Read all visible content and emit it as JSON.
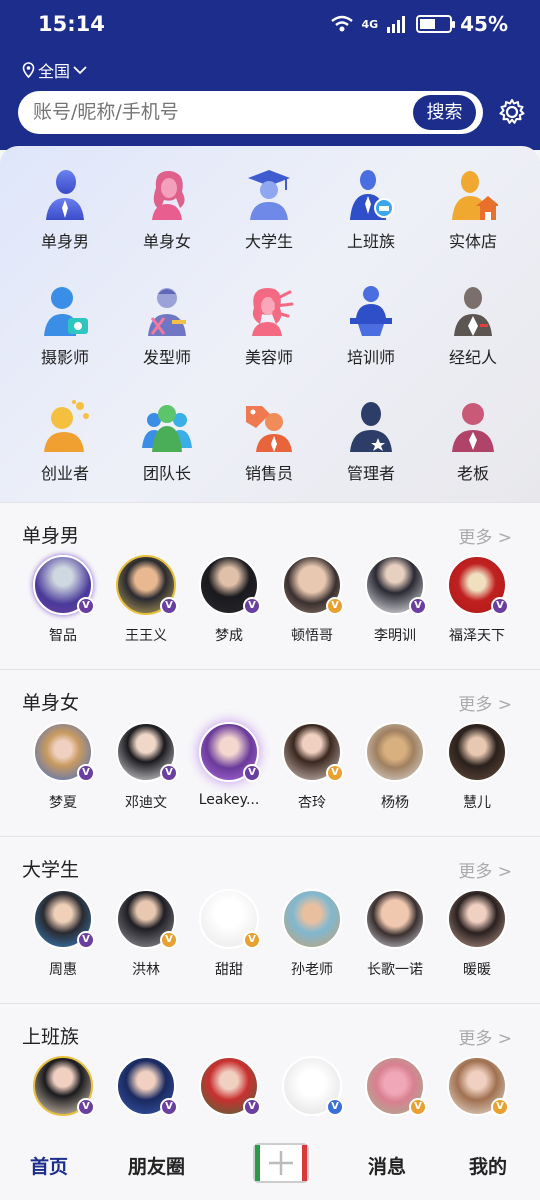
{
  "status": {
    "time": "15:14",
    "network": "4G",
    "battery": "45%",
    "battery_level": 0.45
  },
  "location": {
    "label": "全国"
  },
  "search": {
    "placeholder": "账号/昵称/手机号",
    "button": "搜索"
  },
  "categories": [
    {
      "label": "单身男",
      "icon": "single-man-icon"
    },
    {
      "label": "单身女",
      "icon": "single-woman-icon"
    },
    {
      "label": "大学生",
      "icon": "graduate-icon"
    },
    {
      "label": "上班族",
      "icon": "office-worker-icon"
    },
    {
      "label": "实体店",
      "icon": "store-icon"
    },
    {
      "label": "摄影师",
      "icon": "photographer-icon"
    },
    {
      "label": "发型师",
      "icon": "hairstylist-icon"
    },
    {
      "label": "美容师",
      "icon": "beautician-icon"
    },
    {
      "label": "培训师",
      "icon": "trainer-icon"
    },
    {
      "label": "经纪人",
      "icon": "agent-icon"
    },
    {
      "label": "创业者",
      "icon": "entrepreneur-icon"
    },
    {
      "label": "团队长",
      "icon": "team-leader-icon"
    },
    {
      "label": "销售员",
      "icon": "salesperson-icon"
    },
    {
      "label": "管理者",
      "icon": "manager-icon"
    },
    {
      "label": "老板",
      "icon": "boss-icon"
    }
  ],
  "sections": [
    {
      "title": "单身男",
      "more": "更多 >",
      "people": [
        {
          "name": "智品",
          "badge": "V"
        },
        {
          "name": "王王义",
          "badge": "V"
        },
        {
          "name": "梦成",
          "badge": "V"
        },
        {
          "name": "顿悟哥",
          "badge": "V"
        },
        {
          "name": "李明训",
          "badge": "V"
        },
        {
          "name": "福泽天下",
          "badge": "V"
        }
      ]
    },
    {
      "title": "单身女",
      "more": "更多 >",
      "people": [
        {
          "name": "梦夏",
          "badge": "V"
        },
        {
          "name": "邓迪文",
          "badge": "V"
        },
        {
          "name": "Leakey...",
          "badge": "V"
        },
        {
          "name": "杏玲",
          "badge": "V"
        },
        {
          "name": "杨杨",
          "badge": ""
        },
        {
          "name": "慧儿",
          "badge": ""
        }
      ]
    },
    {
      "title": "大学生",
      "more": "更多 >",
      "people": [
        {
          "name": "周惠",
          "badge": "V"
        },
        {
          "name": "洪林",
          "badge": "V"
        },
        {
          "name": "甜甜",
          "badge": "V"
        },
        {
          "name": "孙老师",
          "badge": ""
        },
        {
          "name": "长歌一诺",
          "badge": ""
        },
        {
          "name": "暖暖",
          "badge": ""
        }
      ]
    },
    {
      "title": "上班族",
      "more": "更多 >",
      "people": [
        {
          "name": "",
          "badge": "V"
        },
        {
          "name": "",
          "badge": "V"
        },
        {
          "name": "",
          "badge": "V"
        },
        {
          "name": "",
          "badge": "V"
        },
        {
          "name": "",
          "badge": "V"
        },
        {
          "name": "",
          "badge": "V"
        }
      ]
    }
  ],
  "tabs": {
    "home": "首页",
    "moments": "朋友圈",
    "messages": "消息",
    "mine": "我的"
  },
  "colors": {
    "brand": "#1c2d8c",
    "vip_purple": "#6b3fa0",
    "vip_orange": "#e8a030",
    "vip_blue": "#3a6fd8"
  }
}
